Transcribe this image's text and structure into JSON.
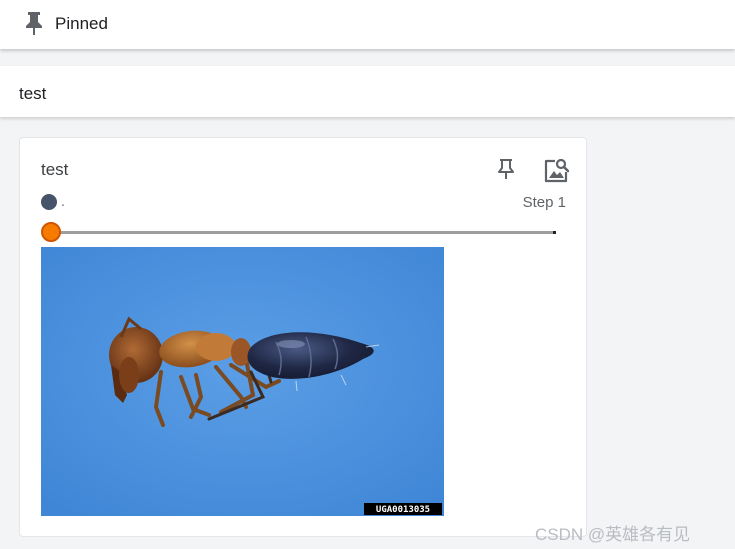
{
  "pinned_header": {
    "icon": "pin-icon",
    "label": "Pinned"
  },
  "group": {
    "label": "test"
  },
  "card": {
    "title": "test",
    "actions": {
      "pin_icon": "pin-icon",
      "image_settings_icon": "image-search-icon"
    },
    "run": {
      "name": ".",
      "color": "#455468"
    },
    "step_label": "Step 1",
    "slider": {
      "value_fraction": 0.0,
      "accent_color": "#f57c00"
    },
    "image": {
      "background_color": "#4a8fdc",
      "tag": "UGA0013035"
    }
  },
  "footer_watermark": "CSDN @英雄各有见"
}
